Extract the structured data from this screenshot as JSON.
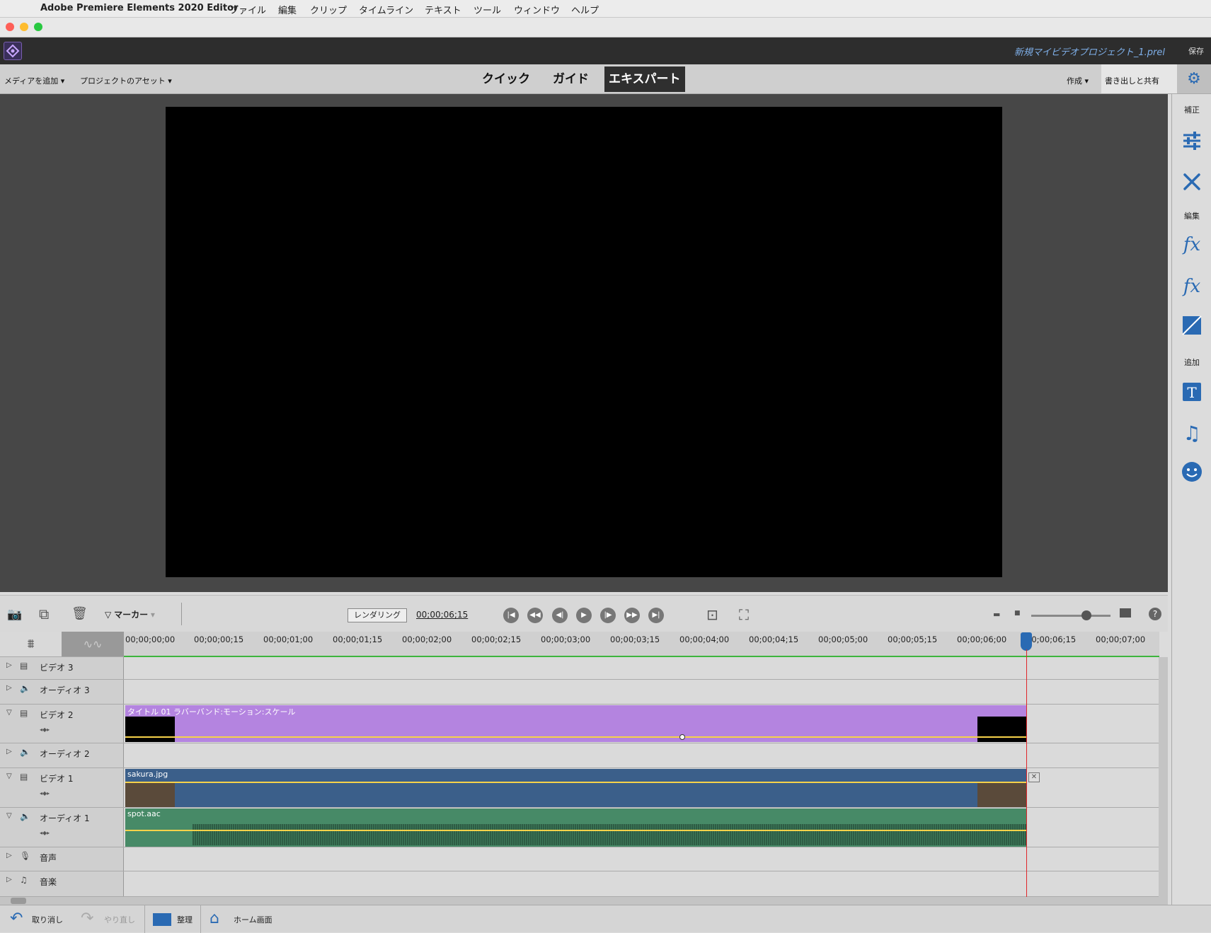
{
  "menubar": {
    "app": "Adobe Premiere Elements 2020 Editor",
    "items": [
      "ファイル",
      "編集",
      "クリップ",
      "タイムライン",
      "テキスト",
      "ツール",
      "ウィンドウ",
      "ヘルプ"
    ]
  },
  "appbar": {
    "project": "新規マイビデオプロジェクト_1.prel",
    "save": "保存"
  },
  "toolbar": {
    "add_media": "メディアを追加",
    "project_assets": "プロジェクトのアセット",
    "modes": [
      "クイック",
      "ガイド",
      "エキスパート"
    ],
    "active_mode": "エキスパート",
    "create": "作成",
    "export_share": "書き出しと共有"
  },
  "right_panel": {
    "adjust": "補正",
    "edit": "編集",
    "add": "追加"
  },
  "timeline_ctrl": {
    "marker": "マーカー",
    "render": "レンダリング",
    "timecode": "00;00;06;15"
  },
  "ruler": {
    "ticks": [
      "00;00;00;00",
      "00;00;00;15",
      "00;00;01;00",
      "00;00;01;15",
      "00;00;02;00",
      "00;00;02;15",
      "00;00;03;00",
      "00;00;03;15",
      "00;00;04;00",
      "00;00;04;15",
      "00;00;05;00",
      "00;00;05;15",
      "00;00;06;00",
      "00;00;06;15",
      "00;00;07;00"
    ]
  },
  "tracks": [
    {
      "name": "ビデオ 3",
      "type": "video"
    },
    {
      "name": "オーディオ 3",
      "type": "audio"
    },
    {
      "name": "ビデオ 2",
      "type": "video",
      "clip": "タイトル 01 ラバーバンド:モーション:スケール",
      "clip_color": "#b484e0"
    },
    {
      "name": "オーディオ 2",
      "type": "audio"
    },
    {
      "name": "ビデオ 1",
      "type": "video",
      "clip": "sakura.jpg",
      "clip_color": "#3b5f8a"
    },
    {
      "name": "オーディオ 1",
      "type": "audio",
      "clip": "spot.aac",
      "clip_color": "#478a67"
    },
    {
      "name": "音声",
      "type": "narration"
    },
    {
      "name": "音楽",
      "type": "music"
    }
  ],
  "statusbar": {
    "undo": "取り消し",
    "redo": "やり直し",
    "organize": "整理",
    "home": "ホーム画面"
  }
}
